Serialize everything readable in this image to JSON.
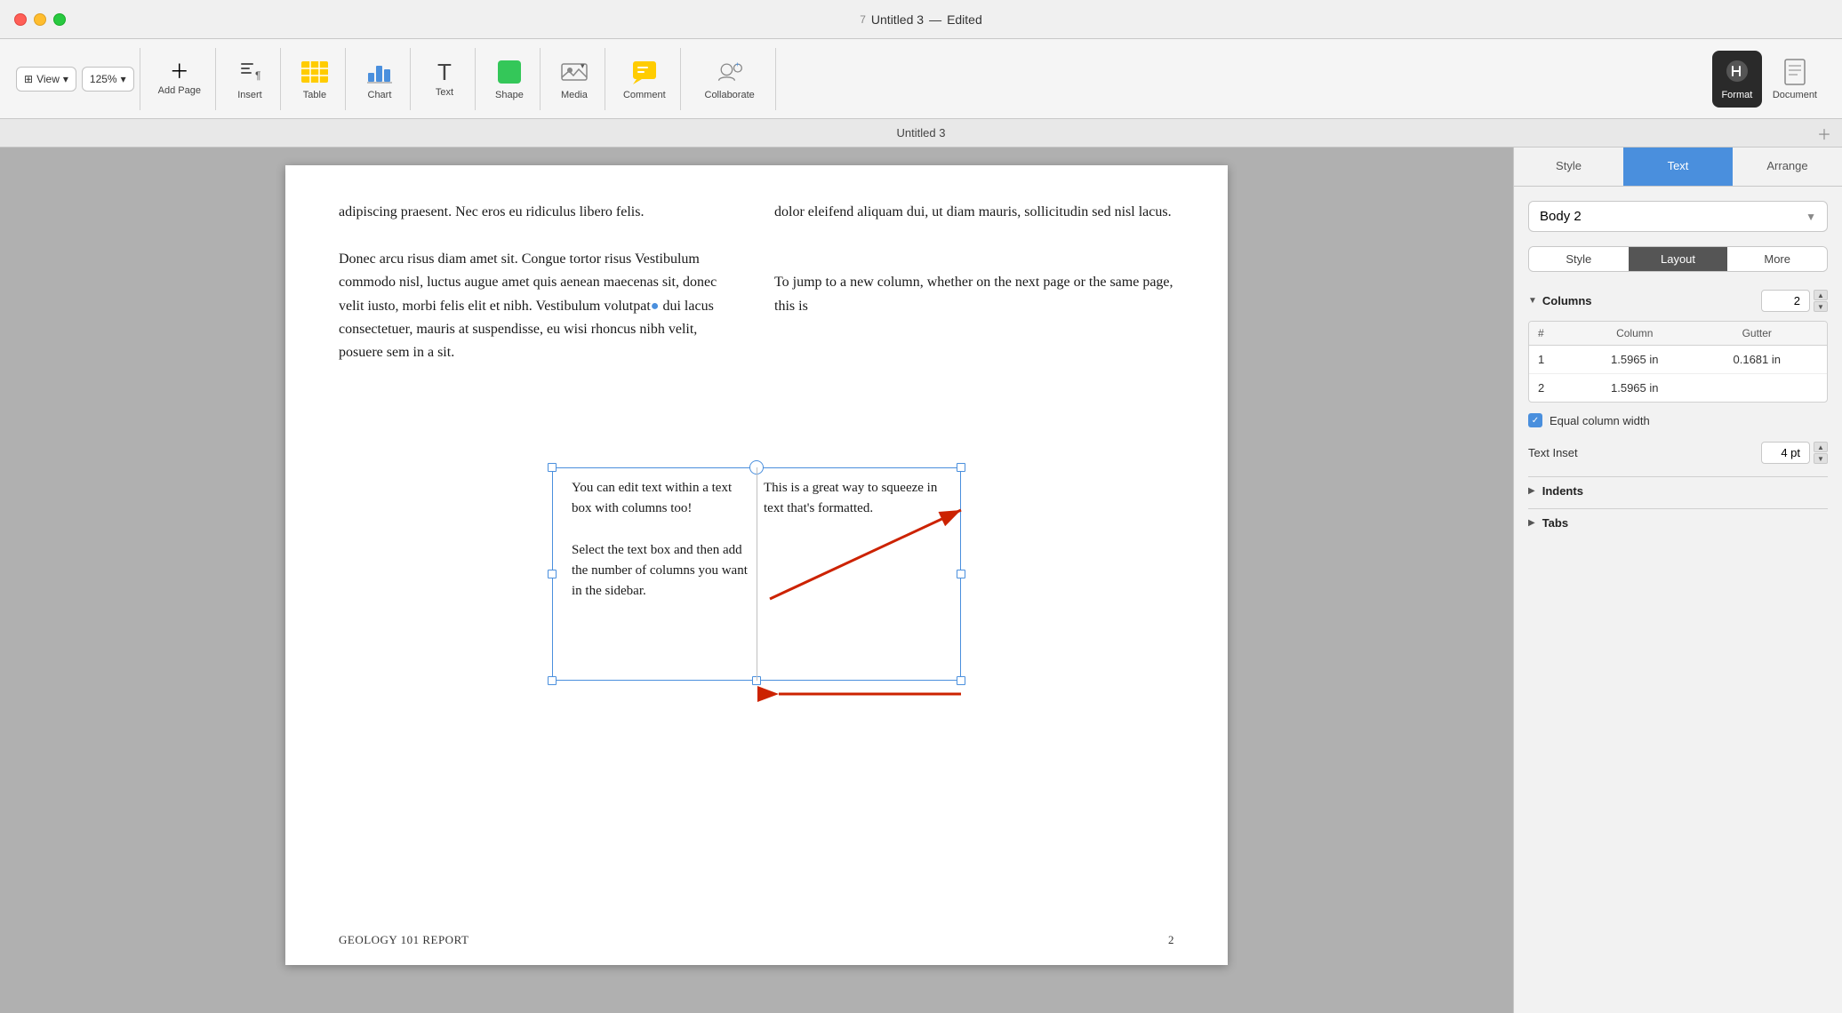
{
  "titlebar": {
    "app_icon": "7",
    "title": "Untitled 3",
    "edited_label": "Edited",
    "separator": "—"
  },
  "toolbar": {
    "view_label": "View",
    "zoom_label": "125%",
    "add_page_label": "Add Page",
    "insert_label": "Insert",
    "table_label": "Table",
    "chart_label": "Chart",
    "text_label": "Text",
    "shape_label": "Shape",
    "media_label": "Media",
    "comment_label": "Comment",
    "collaborate_label": "Collaborate",
    "format_label": "Format",
    "document_label": "Document"
  },
  "tab_bar": {
    "title": "Untitled 3"
  },
  "page": {
    "footer_left": "GEOLOGY 101 REPORT",
    "footer_right": "2",
    "col1_text": "adipiscing praesent. Nec eros eu ridiculus libero felis.\n\nDonec arcu risus diam amet sit. Congue tortor risus Vestibulum commodo nisl, luctus augue amet quis aenean maecenas sit, donec velit iusto, morbi felis elit et nibh. Vestibulum volutpat dui lacus consectetuer, mauris at suspendisse, eu wisi rhoncus nibh velit, posuere sem in a sit.",
    "col2_text": "dolor eleifend aliquam dui, ut diam mauris, sollicitudin sed nisl lacus.\n\nTo jump to a new column, whether on the next page or the same page, this is",
    "textbox_col1": "You can edit text within a text box with columns too!\n\nSelect the text box and then add the number of columns you want in the sidebar.",
    "textbox_col2": "This is a great way to squeeze in text that's formatted."
  },
  "sidebar": {
    "tabs": {
      "style_label": "Style",
      "text_label": "Text",
      "arrange_label": "Arrange"
    },
    "style_dropdown": "Body 2",
    "sub_tabs": {
      "style_label": "Style",
      "layout_label": "Layout",
      "more_label": "More"
    },
    "columns_section": {
      "title": "Columns",
      "count": "2",
      "table_headers": {
        "num": "#",
        "column": "Column",
        "gutter": "Gutter"
      },
      "rows": [
        {
          "num": "1",
          "column": "1.5965 in",
          "gutter": "0.1681 in"
        },
        {
          "num": "2",
          "column": "1.5965 in",
          "gutter": ""
        }
      ]
    },
    "equal_column_width_label": "Equal column width",
    "text_inset_label": "Text Inset",
    "text_inset_value": "4 pt",
    "indents_label": "Indents",
    "tabs_label": "Tabs"
  },
  "colors": {
    "accent_blue": "#4a8fdd",
    "toolbar_active": "#2a2a2a",
    "arrow_red": "#cc2200",
    "checkbox_blue": "#4a8fdd",
    "table_yellow": "#ffcc00",
    "chart_blue": "#4a8fdd"
  }
}
